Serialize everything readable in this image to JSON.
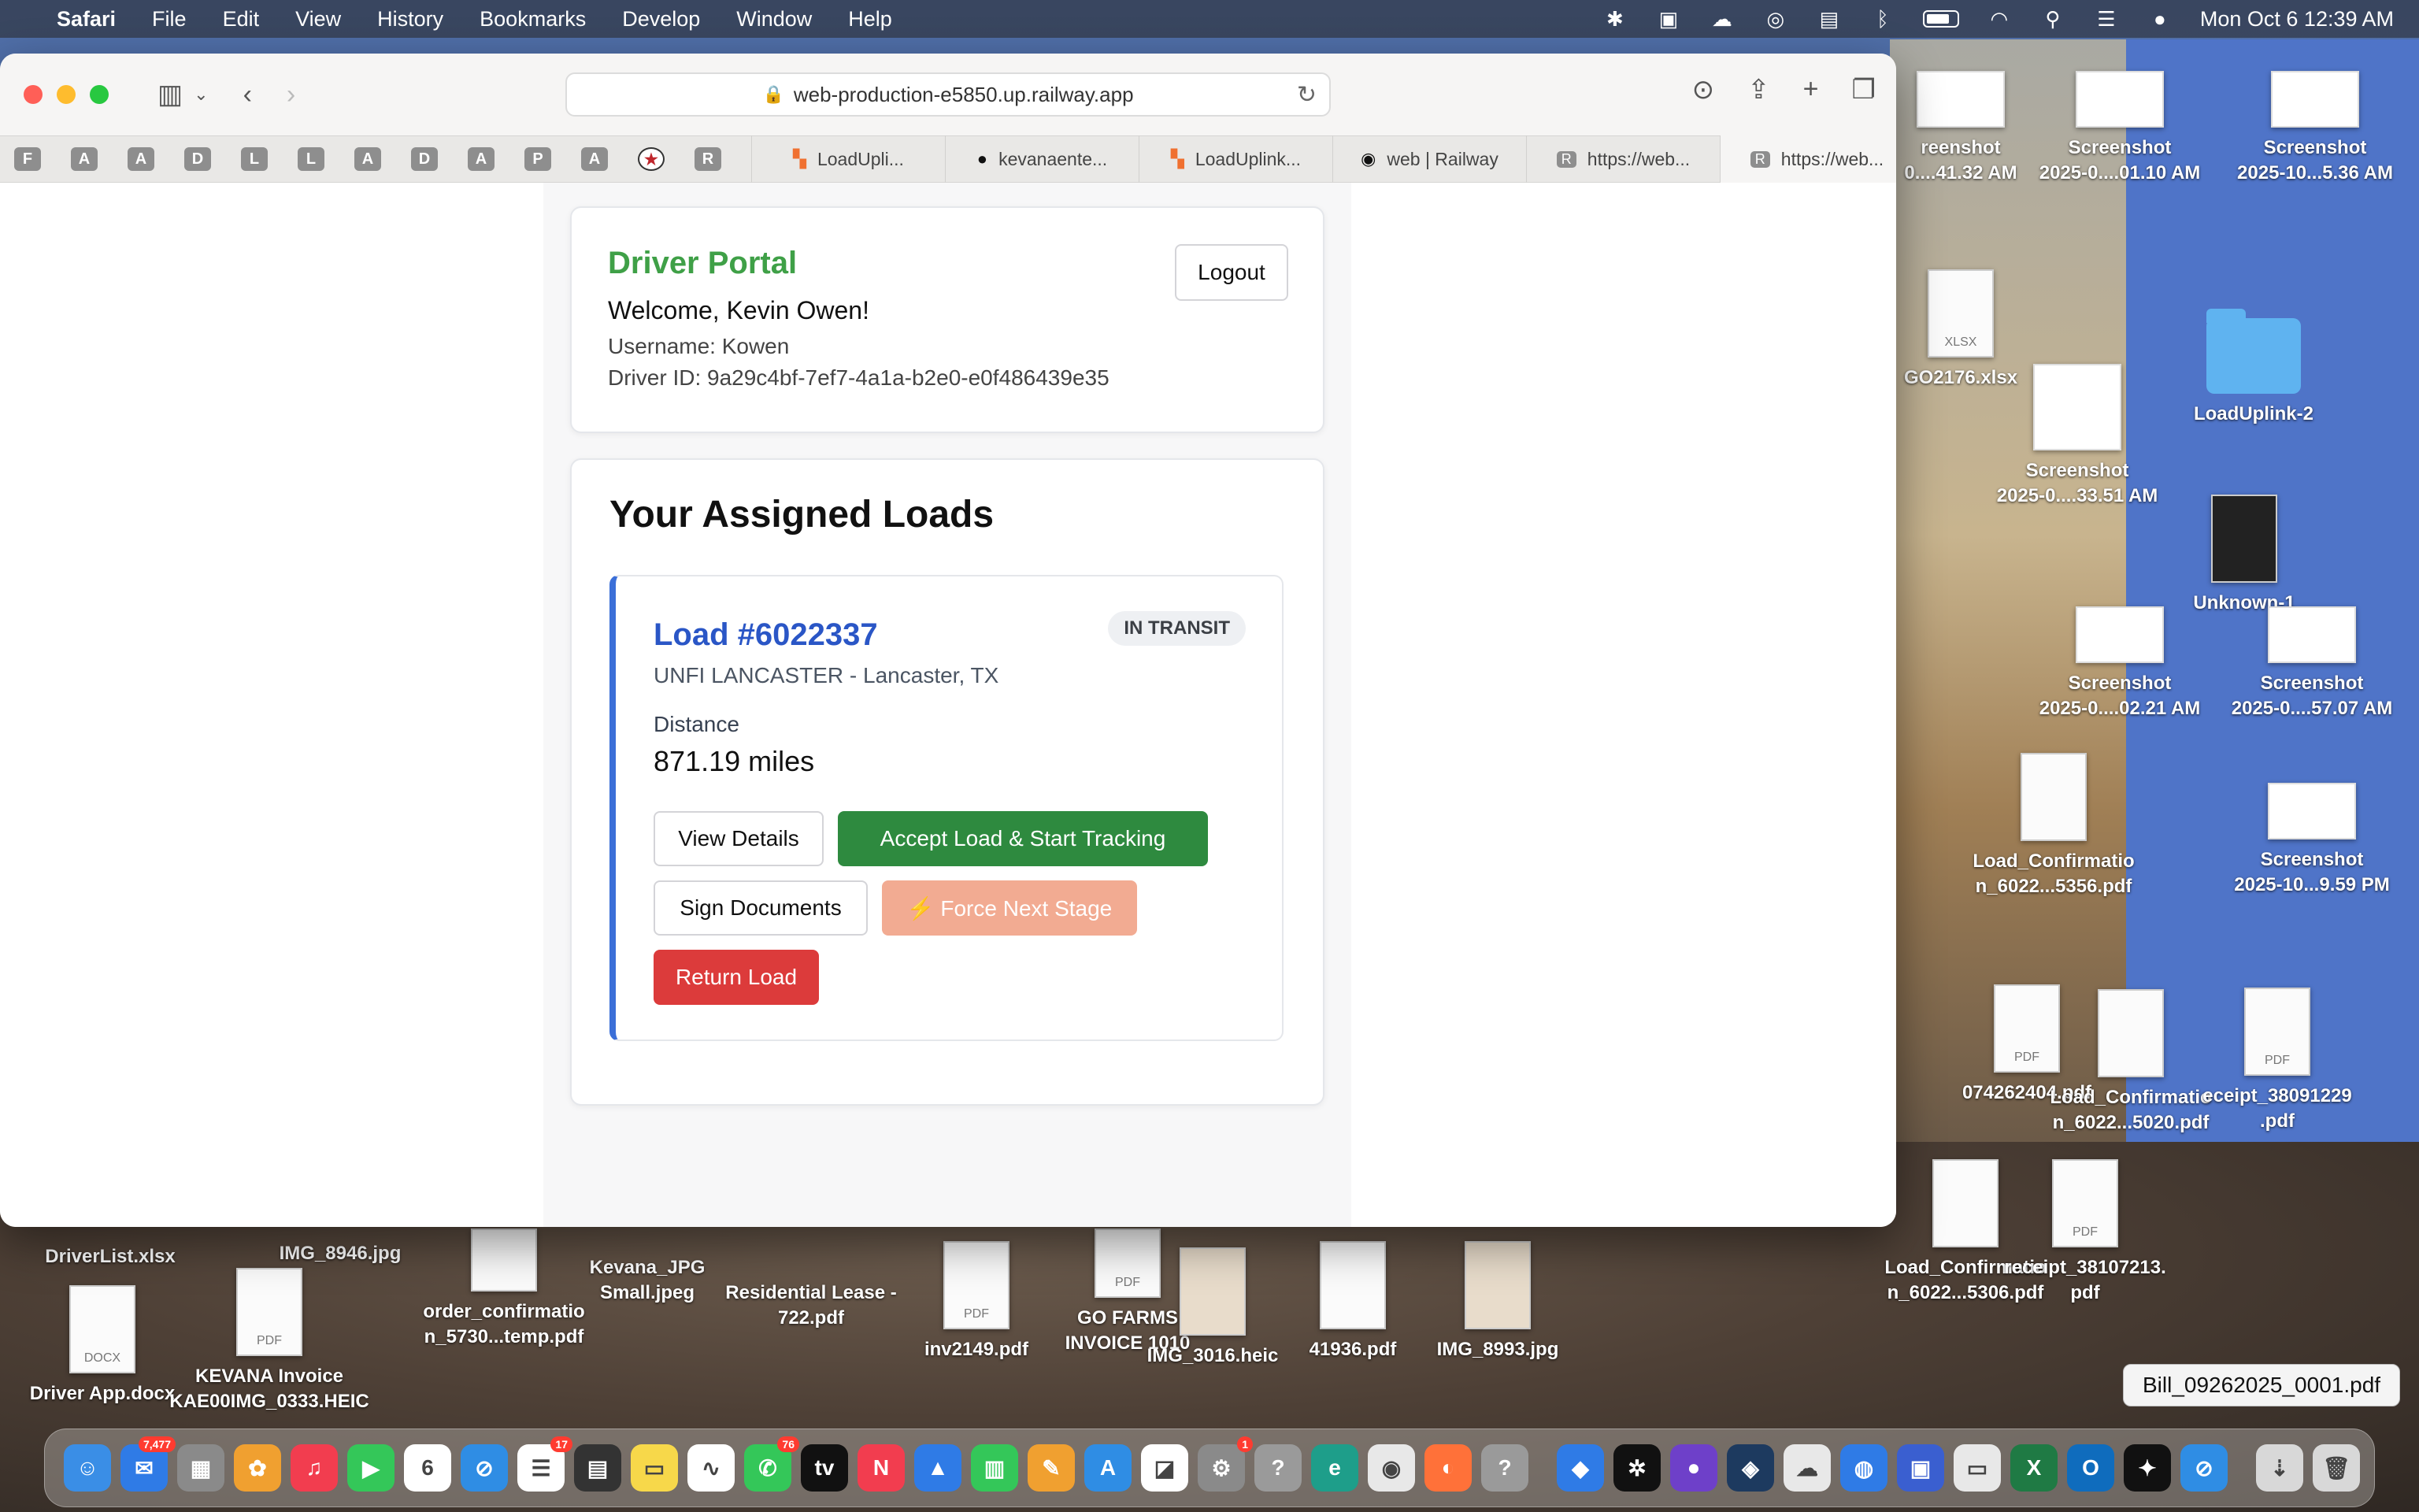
{
  "menubar": {
    "app": "Safari",
    "items": [
      "File",
      "Edit",
      "View",
      "History",
      "Bookmarks",
      "Develop",
      "Window",
      "Help"
    ],
    "datetime": "Mon Oct 6  12:39 AM"
  },
  "browser": {
    "url": "web-production-e5850.up.railway.app",
    "pinned": [
      "F",
      "A",
      "A",
      "D",
      "L",
      "L",
      "A",
      "D",
      "A",
      "P",
      "A",
      "★",
      "R"
    ],
    "tabs": [
      {
        "label": "LoadUpli...",
        "icon": "railway-icon"
      },
      {
        "label": "kevanaente...",
        "icon": "github-icon"
      },
      {
        "label": "LoadUplink...",
        "icon": "railway-icon"
      },
      {
        "label": "web | Railway",
        "icon": "railway-icon"
      },
      {
        "label": "https://web...",
        "icon": "r-icon"
      },
      {
        "label": "https://web...",
        "icon": "r-icon"
      }
    ]
  },
  "portal": {
    "title": "Driver Portal",
    "welcome": "Welcome, Kevin Owen!",
    "username": "Username: Kowen",
    "driver_id": "Driver ID: 9a29c4bf-7ef7-4a1a-b2e0-e0f486439e35",
    "logout_label": "Logout"
  },
  "loads": {
    "heading": "Your Assigned Loads",
    "load": {
      "title": "Load #6022337",
      "status": "IN TRANSIT",
      "destination": "UNFI LANCASTER - Lancaster, TX",
      "distance_label": "Distance",
      "distance_value": "871.19 miles",
      "view_details": "View Details",
      "accept": "Accept Load & Start Tracking",
      "sign_docs": "Sign Documents",
      "force_next": "⚡ Force Next Stage",
      "return": "Return Load"
    }
  },
  "desktop": {
    "icons": [
      {
        "label": "reenshot\n0....41.32 AM",
        "kind": "thumb"
      },
      {
        "label": "Screenshot\n2025-0....01.10 AM",
        "kind": "thumb"
      },
      {
        "label": "Screenshot\n2025-10...5.36 AM",
        "kind": "thumb"
      },
      {
        "label": "GO2176.xlsx",
        "kind": "doc",
        "ext": "XLSX"
      },
      {
        "label": "Screenshot\n2025-0....33.51 AM",
        "kind": "thumb"
      },
      {
        "label": "LoadUplink-2",
        "kind": "folder"
      },
      {
        "label": "Unknown-1",
        "kind": "doc",
        "ext": ""
      },
      {
        "label": "Screenshot\n2025-0....02.21 AM",
        "kind": "thumb"
      },
      {
        "label": "Screenshot\n2025-0....57.07 AM",
        "kind": "thumb"
      },
      {
        "label": "Load_Confirmatio\nn_6022...5356.pdf",
        "kind": "doc",
        "ext": ""
      },
      {
        "label": "Screenshot\n2025-10...9.59 PM",
        "kind": "thumb"
      },
      {
        "label": "074262404.pdf",
        "kind": "doc",
        "ext": "PDF"
      },
      {
        "label": "Load_Confirmatio\nn_6022...5020.pdf",
        "kind": "doc",
        "ext": ""
      },
      {
        "label": "eceipt_38091229\n.pdf",
        "kind": "doc",
        "ext": "PDF"
      },
      {
        "label": "Load_Confirmatio\nn_6022...5306.pdf",
        "kind": "doc",
        "ext": ""
      },
      {
        "label": "receipt_38107213.\npdf",
        "kind": "doc",
        "ext": "PDF"
      },
      {
        "label": "DriverList.xlsx",
        "kind": "none"
      },
      {
        "label": "IMG_8946.jpg",
        "kind": "none"
      },
      {
        "label": "order_confirmatio\nn_5730...temp.pdf",
        "kind": "doc",
        "ext": ""
      },
      {
        "label": "Kevana_JPG\nSmall.jpeg",
        "kind": "none"
      },
      {
        "label": "Residential Lease -\n722.pdf",
        "kind": "none"
      },
      {
        "label": "inv2149.pdf",
        "kind": "doc",
        "ext": "PDF"
      },
      {
        "label": "GO FARMS\nINVOICE 1010",
        "kind": "doc",
        "ext": "PDF"
      },
      {
        "label": "IMG_3016.heic",
        "kind": "doc",
        "ext": ""
      },
      {
        "label": "41936.pdf",
        "kind": "doc",
        "ext": ""
      },
      {
        "label": "IMG_8993.jpg",
        "kind": "doc",
        "ext": ""
      },
      {
        "label": "Driver App.docx",
        "kind": "doc",
        "ext": "DOCX"
      },
      {
        "label": "KEVANA Invoice\nKAE00IMG_0333.HEIC",
        "kind": "doc",
        "ext": "PDF"
      }
    ],
    "tooltip": "Bill_09262025_0001.pdf"
  },
  "dock": {
    "apps": [
      {
        "name": "finder-icon",
        "color": "#3a8ee6"
      },
      {
        "name": "mail-icon",
        "color": "#2f7be6",
        "badge": "7,477"
      },
      {
        "name": "launchpad-icon",
        "color": "#8a8a8a"
      },
      {
        "name": "photos-icon",
        "color": "#f0a030"
      },
      {
        "name": "music-icon",
        "color": "#f23d4f"
      },
      {
        "name": "facetime-icon",
        "color": "#34c759"
      },
      {
        "name": "calendar-icon",
        "color": "#ffffff"
      },
      {
        "name": "safari-icon",
        "color": "#2f8de4"
      },
      {
        "name": "reminders-icon",
        "color": "#ffffff",
        "badge": "17"
      },
      {
        "name": "calculator-icon",
        "color": "#333333"
      },
      {
        "name": "notes-icon",
        "color": "#f7d84a"
      },
      {
        "name": "freeform-icon",
        "color": "#ffffff"
      },
      {
        "name": "messages-icon",
        "color": "#34c759",
        "badge": "76"
      },
      {
        "name": "tv-icon",
        "color": "#111111"
      },
      {
        "name": "news-icon",
        "color": "#f23d4f"
      },
      {
        "name": "keynote-icon",
        "color": "#2f7be6"
      },
      {
        "name": "numbers-icon",
        "color": "#34c759"
      },
      {
        "name": "pages-icon",
        "color": "#f0a030"
      },
      {
        "name": "appstore-icon",
        "color": "#2f8de4"
      },
      {
        "name": "preview-icon",
        "color": "#ffffff"
      },
      {
        "name": "settings-icon",
        "color": "#8a8a8a",
        "badge": "1"
      },
      {
        "name": "unknown-app-icon",
        "color": "#9a9a9a"
      },
      {
        "name": "edge-icon",
        "color": "#1e9e8a"
      },
      {
        "name": "chrome-icon",
        "color": "#e8e8e8"
      },
      {
        "name": "firefox-icon",
        "color": "#ff7139"
      },
      {
        "name": "unknown-app-icon",
        "color": "#9a9a9a"
      },
      {
        "name": "copilot-icon",
        "color": "#2f7be6"
      },
      {
        "name": "chatgpt-icon",
        "color": "#111111"
      },
      {
        "name": "github-icon",
        "color": "#6e40c9"
      },
      {
        "name": "docker-icon",
        "color": "#1d3a5f"
      },
      {
        "name": "creative-cloud-icon",
        "color": "#e8e8e8"
      },
      {
        "name": "network-icon",
        "color": "#2f7be6"
      },
      {
        "name": "printer-icon",
        "color": "#3a5fd0"
      },
      {
        "name": "finder-window-icon",
        "color": "#e8e8e8"
      },
      {
        "name": "excel-icon",
        "color": "#1f7a44"
      },
      {
        "name": "outlook-icon",
        "color": "#0f6cbd"
      },
      {
        "name": "cursor-icon",
        "color": "#111111"
      },
      {
        "name": "safari-small-icon",
        "color": "#2f8de4"
      },
      {
        "name": "downloads-icon",
        "color": "#d8d8d8"
      },
      {
        "name": "trash-icon",
        "color": "#d8d8d8"
      }
    ]
  }
}
